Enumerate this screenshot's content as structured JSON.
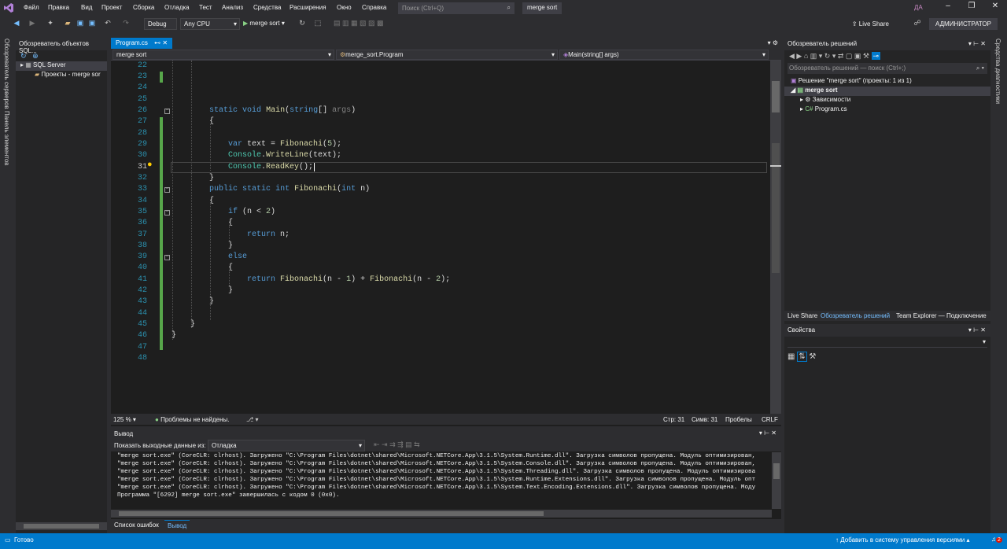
{
  "menu": [
    "Файл",
    "Правка",
    "Вид",
    "Проект",
    "Сборка",
    "Отладка",
    "Тест",
    "Анализ",
    "Средства",
    "Расширения",
    "Окно",
    "Справка"
  ],
  "search": {
    "placeholder": "Поиск (Ctrl+Q)"
  },
  "solution_name": "merge sort",
  "user_initials": "ДА",
  "toolbar": {
    "config": "Debug",
    "platform": "Any CPU",
    "run_label": "merge sort",
    "live_share": "Live Share",
    "admin": "АДМИНИСТРАТОР"
  },
  "left_tabs": [
    "Обозреватель серверов",
    "Панель элементов"
  ],
  "object_explorer": {
    "title": "Обозреватель объектов SQL...",
    "items": [
      "SQL Server",
      "Проекты - merge sor"
    ]
  },
  "editor": {
    "tab": "Program.cs",
    "nav": [
      "merge sort",
      "merge_sort.Program",
      "Main(string[] args)"
    ],
    "line_numbers": [
      "22",
      "23",
      "24",
      "25",
      "26",
      "27",
      "28",
      "29",
      "30",
      "31",
      "32",
      "33",
      "34",
      "35",
      "36",
      "37",
      "38",
      "39",
      "40",
      "41",
      "42",
      "43",
      "44",
      "45",
      "46",
      "47",
      "48"
    ],
    "code": {
      "l26a": "static",
      "l26b": "void",
      "l26c": "Main",
      "l26d": "(",
      "l26e": "string",
      "l26f": "[] ",
      "l26g": "args",
      "l26h": ")",
      "l27": "{",
      "l29a": "var",
      "l29b": " text = ",
      "l29c": "Fibonachi",
      "l29d": "(",
      "l29e": "5",
      "l29f": ");",
      "l30a": "Console",
      "l30b": ".",
      "l30c": "WriteLine",
      "l30d": "(text);",
      "l31a": "Console",
      "l31b": ".",
      "l31c": "ReadKey",
      "l31d": "();",
      "l32": "}",
      "l33a": "public",
      "l33b": "static",
      "l33c": "int",
      "l33d": "Fibonachi",
      "l33e": "(",
      "l33f": "int",
      "l33g": " n)",
      "l34": "{",
      "l35a": "if",
      "l35b": " (n < ",
      "l35c": "2",
      "l35d": ")",
      "l36": "{",
      "l37a": "return",
      "l37b": " n;",
      "l38": "}",
      "l39": "else",
      "l40": "{",
      "l41a": "return",
      "l41b": " ",
      "l41c": "Fibonachi",
      "l41d": "(n - ",
      "l41e": "1",
      "l41f": ") + ",
      "l41g": "Fibonachi",
      "l41h": "(n - ",
      "l41i": "2",
      "l41j": ");",
      "l42": "}",
      "l43": "}",
      "l45": "}",
      "l46": "}"
    },
    "status": {
      "zoom": "125 %",
      "problems": "Проблемы не найдены.",
      "line": "Стр: 31",
      "col": "Симв: 31",
      "spaces": "Пробелы",
      "eol": "CRLF"
    }
  },
  "output": {
    "title": "Вывод",
    "source_label": "Показать выходные данные из:",
    "source_value": "Отладка",
    "lines": [
      "\"merge sort.exe\" (CoreCLR: clrhost). Загружено \"C:\\Program Files\\dotnet\\shared\\Microsoft.NETCore.App\\3.1.5\\System.Runtime.dll\". Загрузка символов пропущена. Модуль оптимизирован,",
      "\"merge sort.exe\" (CoreCLR: clrhost). Загружено \"C:\\Program Files\\dotnet\\shared\\Microsoft.NETCore.App\\3.1.5\\System.Console.dll\". Загрузка символов пропущена. Модуль оптимизирован,",
      "\"merge sort.exe\" (CoreCLR: clrhost). Загружено \"C:\\Program Files\\dotnet\\shared\\Microsoft.NETCore.App\\3.1.5\\System.Threading.dll\". Загрузка символов пропущена. Модуль оптимизирова",
      "\"merge sort.exe\" (CoreCLR: clrhost). Загружено \"C:\\Program Files\\dotnet\\shared\\Microsoft.NETCore.App\\3.1.5\\System.Runtime.Extensions.dll\". Загрузка символов пропущена. Модуль опт",
      "\"merge sort.exe\" (CoreCLR: clrhost). Загружено \"C:\\Program Files\\dotnet\\shared\\Microsoft.NETCore.App\\3.1.5\\System.Text.Encoding.Extensions.dll\". Загрузка символов пропущена. Моду",
      "Программа \"[6292] merge sort.exe\" завершилась с кодом 0 (0x0)."
    ]
  },
  "bottom_tabs": [
    "Список ошибок",
    "Вывод"
  ],
  "solution_explorer": {
    "title": "Обозреватель решений",
    "search_placeholder": "Обозреватель решений — поиск (Ctrl+;)",
    "solution_label": "Решение \"merge sort\" (проекты: 1 из 1)",
    "project": "merge sort",
    "deps": "Зависимости",
    "file": "Program.cs",
    "tabs": [
      "Live Share",
      "Обозреватель решений",
      "Team Explorer — Подключение"
    ]
  },
  "properties": {
    "title": "Свойства"
  },
  "right_tab": "Средства диагностики",
  "statusbar": {
    "ready": "Готово",
    "vcs": "Добавить в систему управления версиями",
    "notif": "2"
  },
  "colors": {
    "accent": "#007acc",
    "bg": "#1e1e1e",
    "chrome": "#2d2d30",
    "keyword": "#569cd6",
    "type": "#4ec9b0",
    "method": "#dcdcaa",
    "number": "#b5cea8",
    "param": "#9cdcfe",
    "linenum": "#2b91af"
  }
}
